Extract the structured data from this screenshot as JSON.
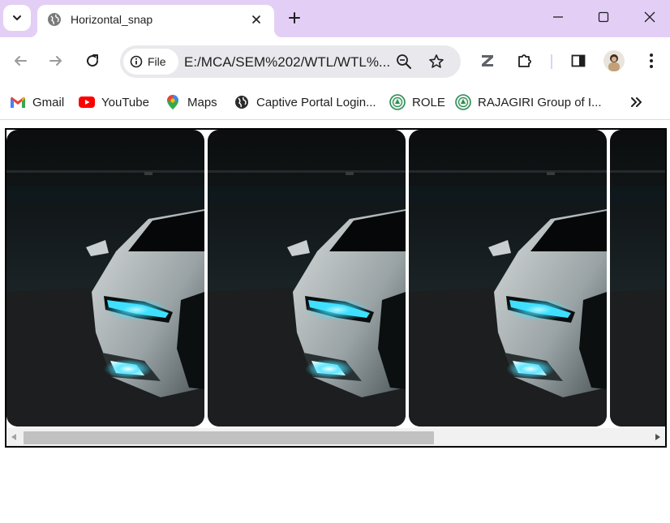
{
  "browser": {
    "tab": {
      "title": "Horizontal_snap",
      "favicon": "globe-icon"
    },
    "window_controls": [
      "minimize-icon",
      "maximize-icon",
      "close-icon"
    ],
    "omnibox": {
      "chip_label": "File",
      "url": "E:/MCA/SEM%202/WTL/WTL%..."
    },
    "bookmarks": [
      {
        "label": "Gmail",
        "icon": "gmail-icon"
      },
      {
        "label": "YouTube",
        "icon": "youtube-icon"
      },
      {
        "label": "Maps",
        "icon": "maps-icon"
      },
      {
        "label": "Captive Portal Login...",
        "icon": "globe-icon"
      },
      {
        "label": "ROLE",
        "icon": "rajagiri-logo-icon"
      },
      {
        "label": "RAJAGIRI Group of I...",
        "icon": "rajagiri-logo-icon"
      }
    ]
  },
  "colors": {
    "tabstrip": "#e3cff6",
    "omnibox": "#e9e9ed",
    "scroll_thumb": "#c1c1c1",
    "headlight": "#3fe0ff"
  },
  "page": {
    "snap_cards": [
      {
        "image": "car-headlight-image"
      },
      {
        "image": "car-headlight-image"
      },
      {
        "image": "car-headlight-image"
      },
      {
        "image": "car-headlight-image"
      }
    ],
    "scroll_position_fraction": 0.0
  }
}
